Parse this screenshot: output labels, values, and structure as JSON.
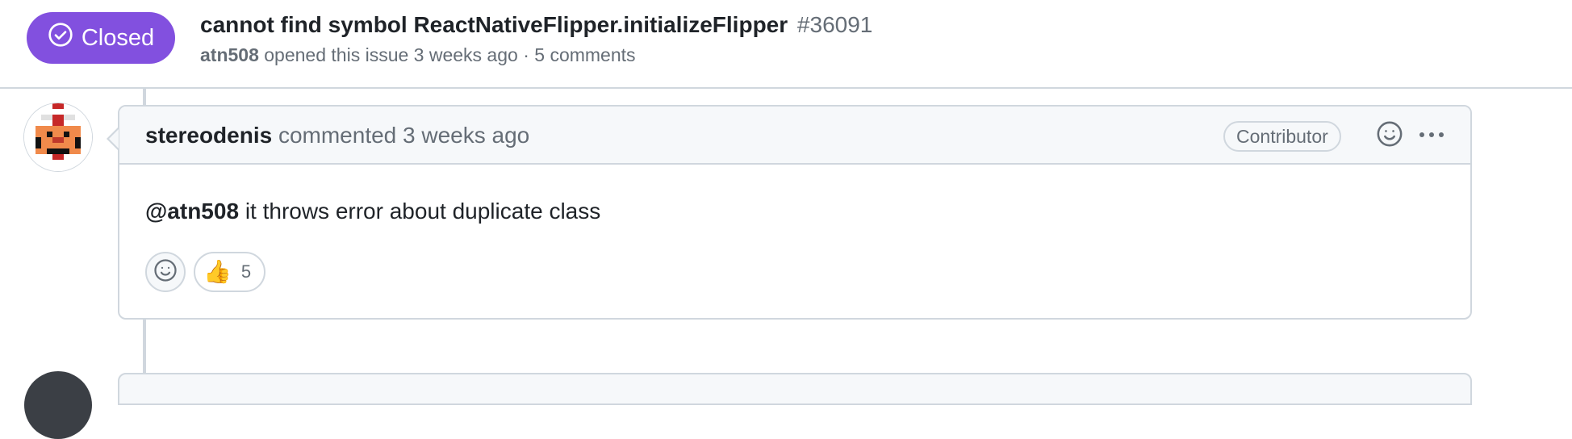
{
  "issue": {
    "state": "Closed",
    "state_color": "#8250df",
    "title": "cannot find symbol ReactNativeFlipper.initializeFlipper",
    "number": "#36091",
    "author": "atn508",
    "opened_text": "opened this issue 3 weeks ago",
    "separator": "·",
    "comments_count": "5 comments"
  },
  "comment": {
    "author": "stereodenis",
    "action": "commented 3 weeks ago",
    "role_badge": "Contributor",
    "mention": "@atn508",
    "body": "it throws error about duplicate class",
    "reactions": [
      {
        "emoji": "👍",
        "icon": "thumbs-up-icon",
        "count": "5"
      }
    ]
  },
  "icons": {
    "state": "check-circle-icon",
    "add_reaction": "smiley-icon",
    "more": "kebab-horizontal-icon"
  }
}
